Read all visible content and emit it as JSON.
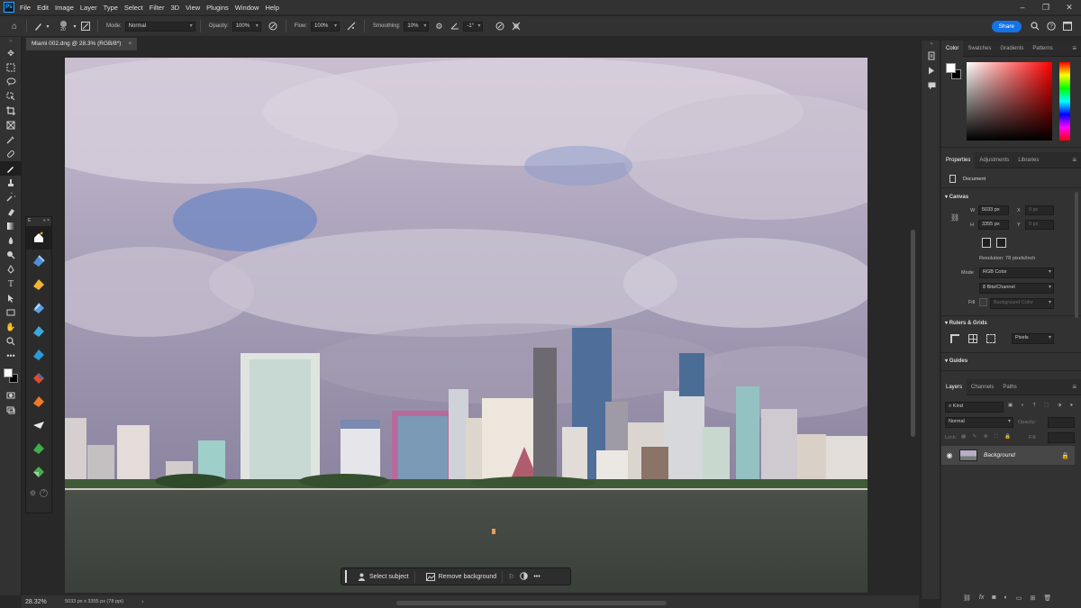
{
  "menu": {
    "logo": "Ps",
    "items": [
      "File",
      "Edit",
      "Image",
      "Layer",
      "Type",
      "Select",
      "Filter",
      "3D",
      "View",
      "Plugins",
      "Window",
      "Help"
    ]
  },
  "window_controls": {
    "minimize": "–",
    "maximize": "❐",
    "close": "✕"
  },
  "options_bar": {
    "brush_size": "20",
    "mode_label": "Mode:",
    "mode_value": "Normal",
    "opacity_label": "Opacity:",
    "opacity_value": "100%",
    "flow_label": "Flow:",
    "flow_value": "100%",
    "smoothing_label": "Smoothing:",
    "smoothing_value": "10%",
    "angle_value": "-1°",
    "share_label": "Share"
  },
  "document_tab": {
    "title": "Miami 002.dng @ 28.3% (RGB/8*)",
    "close": "×"
  },
  "plugin_panel": {
    "title": "E",
    "controls": "« ×"
  },
  "context_bar": {
    "select_subject": "Select subject",
    "remove_background": "Remove background",
    "more": "•••"
  },
  "status": {
    "zoom": "28.32%",
    "doc_info": "5033 px x 3355 px (78 ppi)",
    "arrow": "›"
  },
  "color_panel": {
    "tabs": [
      "Color",
      "Swatches",
      "Gradients",
      "Patterns"
    ],
    "active_tab": "Color",
    "foreground": "#ffffff",
    "background": "#000000",
    "hue": "#ff0000"
  },
  "properties_panel": {
    "tabs": [
      "Properties",
      "Adjustments",
      "Libraries"
    ],
    "active_tab": "Properties",
    "doc_label": "Document",
    "canvas_section": "Canvas",
    "w_label": "W",
    "w_value": "5033 px",
    "h_label": "H",
    "h_value": "3355 px",
    "x_label": "X",
    "x_value": "0 px",
    "y_label": "Y",
    "y_value": "0 px",
    "resolution": "Resolution: 78 pixels/inch",
    "mode_label": "Mode",
    "mode_value": "RGB Color",
    "depth_value": "8 Bits/Channel",
    "fill_label": "Fill",
    "fill_value": "Background Color",
    "rulers_section": "Rulers & Grids",
    "units_value": "Pixels",
    "guides_section": "Guides"
  },
  "layers_panel": {
    "tabs": [
      "Layers",
      "Channels",
      "Paths"
    ],
    "active_tab": "Layers",
    "kind_label": "Kind",
    "blend_mode": "Normal",
    "opacity_label": "Opacity:",
    "lock_label": "Lock:",
    "fill_label": "Fill:",
    "layers": [
      {
        "name": "Background",
        "visible": true,
        "locked": true
      }
    ],
    "footer_icons": [
      "link-icon",
      "fx-icon",
      "mask-icon",
      "adjustment-icon",
      "group-icon",
      "new-layer-icon",
      "delete-icon"
    ]
  }
}
